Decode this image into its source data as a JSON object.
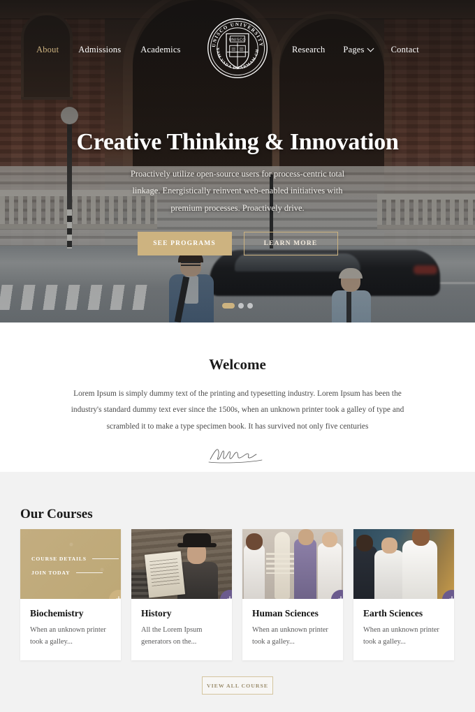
{
  "brand": {
    "seal_top_text": "UNISCO UNIVERSITY",
    "seal_bottom_text": "SATYAM VADA DHARMAM CHARA",
    "seal_shield_text": "UNISCO",
    "seal_icon": "university-seal-book-icon"
  },
  "colors": {
    "gold": "#cdb380",
    "purple": "#6b5b8e",
    "dark": "#1b1b1b",
    "section_gray": "#f2f2f2"
  },
  "nav": {
    "left_items": [
      {
        "label": "About",
        "active": true
      },
      {
        "label": "Admissions",
        "active": false
      },
      {
        "label": "Academics",
        "active": false
      }
    ],
    "right_items": [
      {
        "label": "Research",
        "has_dropdown": false
      },
      {
        "label": "Pages",
        "has_dropdown": true
      },
      {
        "label": "Contact",
        "has_dropdown": false
      }
    ],
    "dropdown_icon": "chevron-down-icon"
  },
  "hero": {
    "title": "Creative Thinking & Innovation",
    "description": "Proactively utilize open-source users for process-centric total linkage. Energistically reinvent web-enabled initiatives with premium processes. Proactively drive.",
    "primary_button": "SEE PROGRAMS",
    "secondary_button": "LEARN MORE",
    "slides_total": 3,
    "active_slide": 1
  },
  "welcome": {
    "heading": "Welcome",
    "body": "Lorem Ipsum is simply dummy text of the printing and typesetting industry. Lorem Ipsum has been the industry's standard dummy text ever since the 1500s, when an unknown printer took a galley of type and scrambled it to make a type specimen book. It has survived not only five centuries",
    "signature_icon": "handwritten-signature-icon"
  },
  "courses": {
    "heading": "Our Courses",
    "overlay": {
      "details_label": "COURSE DETAILS",
      "join_label": "JOIN TODAY"
    },
    "plus_icon": "plus-icon",
    "items": [
      {
        "title": "Biochemistry",
        "description": "When an unknown printer took a galley...",
        "plus_color": "gold",
        "overlay_visible": true,
        "media": "biochemistry-molecule-image"
      },
      {
        "title": "History",
        "description": "All the Lorem Ipsum generators on the...",
        "plus_color": "purple",
        "overlay_visible": false,
        "media": "history-newspaper-man-image"
      },
      {
        "title": "Human Sciences",
        "description": "When an unknown printer took a galley...",
        "plus_color": "purple",
        "overlay_visible": false,
        "media": "human-sciences-skeleton-class-image"
      },
      {
        "title": "Earth Sciences",
        "description": "When an unknown printer took a galley...",
        "plus_color": "purple",
        "overlay_visible": false,
        "media": "earth-sciences-lab-image"
      }
    ],
    "view_all_button": "VIEW ALL COURSE"
  }
}
